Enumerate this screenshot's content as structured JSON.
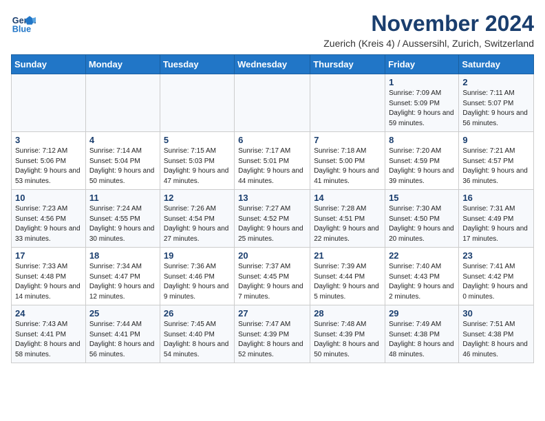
{
  "logo": {
    "line1": "General",
    "line2": "Blue"
  },
  "title": "November 2024",
  "subtitle": "Zuerich (Kreis 4) / Aussersihl, Zurich, Switzerland",
  "days_of_week": [
    "Sunday",
    "Monday",
    "Tuesday",
    "Wednesday",
    "Thursday",
    "Friday",
    "Saturday"
  ],
  "weeks": [
    [
      {
        "day": "",
        "info": ""
      },
      {
        "day": "",
        "info": ""
      },
      {
        "day": "",
        "info": ""
      },
      {
        "day": "",
        "info": ""
      },
      {
        "day": "",
        "info": ""
      },
      {
        "day": "1",
        "info": "Sunrise: 7:09 AM\nSunset: 5:09 PM\nDaylight: 9 hours and 59 minutes."
      },
      {
        "day": "2",
        "info": "Sunrise: 7:11 AM\nSunset: 5:07 PM\nDaylight: 9 hours and 56 minutes."
      }
    ],
    [
      {
        "day": "3",
        "info": "Sunrise: 7:12 AM\nSunset: 5:06 PM\nDaylight: 9 hours and 53 minutes."
      },
      {
        "day": "4",
        "info": "Sunrise: 7:14 AM\nSunset: 5:04 PM\nDaylight: 9 hours and 50 minutes."
      },
      {
        "day": "5",
        "info": "Sunrise: 7:15 AM\nSunset: 5:03 PM\nDaylight: 9 hours and 47 minutes."
      },
      {
        "day": "6",
        "info": "Sunrise: 7:17 AM\nSunset: 5:01 PM\nDaylight: 9 hours and 44 minutes."
      },
      {
        "day": "7",
        "info": "Sunrise: 7:18 AM\nSunset: 5:00 PM\nDaylight: 9 hours and 41 minutes."
      },
      {
        "day": "8",
        "info": "Sunrise: 7:20 AM\nSunset: 4:59 PM\nDaylight: 9 hours and 39 minutes."
      },
      {
        "day": "9",
        "info": "Sunrise: 7:21 AM\nSunset: 4:57 PM\nDaylight: 9 hours and 36 minutes."
      }
    ],
    [
      {
        "day": "10",
        "info": "Sunrise: 7:23 AM\nSunset: 4:56 PM\nDaylight: 9 hours and 33 minutes."
      },
      {
        "day": "11",
        "info": "Sunrise: 7:24 AM\nSunset: 4:55 PM\nDaylight: 9 hours and 30 minutes."
      },
      {
        "day": "12",
        "info": "Sunrise: 7:26 AM\nSunset: 4:54 PM\nDaylight: 9 hours and 27 minutes."
      },
      {
        "day": "13",
        "info": "Sunrise: 7:27 AM\nSunset: 4:52 PM\nDaylight: 9 hours and 25 minutes."
      },
      {
        "day": "14",
        "info": "Sunrise: 7:28 AM\nSunset: 4:51 PM\nDaylight: 9 hours and 22 minutes."
      },
      {
        "day": "15",
        "info": "Sunrise: 7:30 AM\nSunset: 4:50 PM\nDaylight: 9 hours and 20 minutes."
      },
      {
        "day": "16",
        "info": "Sunrise: 7:31 AM\nSunset: 4:49 PM\nDaylight: 9 hours and 17 minutes."
      }
    ],
    [
      {
        "day": "17",
        "info": "Sunrise: 7:33 AM\nSunset: 4:48 PM\nDaylight: 9 hours and 14 minutes."
      },
      {
        "day": "18",
        "info": "Sunrise: 7:34 AM\nSunset: 4:47 PM\nDaylight: 9 hours and 12 minutes."
      },
      {
        "day": "19",
        "info": "Sunrise: 7:36 AM\nSunset: 4:46 PM\nDaylight: 9 hours and 9 minutes."
      },
      {
        "day": "20",
        "info": "Sunrise: 7:37 AM\nSunset: 4:45 PM\nDaylight: 9 hours and 7 minutes."
      },
      {
        "day": "21",
        "info": "Sunrise: 7:39 AM\nSunset: 4:44 PM\nDaylight: 9 hours and 5 minutes."
      },
      {
        "day": "22",
        "info": "Sunrise: 7:40 AM\nSunset: 4:43 PM\nDaylight: 9 hours and 2 minutes."
      },
      {
        "day": "23",
        "info": "Sunrise: 7:41 AM\nSunset: 4:42 PM\nDaylight: 9 hours and 0 minutes."
      }
    ],
    [
      {
        "day": "24",
        "info": "Sunrise: 7:43 AM\nSunset: 4:41 PM\nDaylight: 8 hours and 58 minutes."
      },
      {
        "day": "25",
        "info": "Sunrise: 7:44 AM\nSunset: 4:41 PM\nDaylight: 8 hours and 56 minutes."
      },
      {
        "day": "26",
        "info": "Sunrise: 7:45 AM\nSunset: 4:40 PM\nDaylight: 8 hours and 54 minutes."
      },
      {
        "day": "27",
        "info": "Sunrise: 7:47 AM\nSunset: 4:39 PM\nDaylight: 8 hours and 52 minutes."
      },
      {
        "day": "28",
        "info": "Sunrise: 7:48 AM\nSunset: 4:39 PM\nDaylight: 8 hours and 50 minutes."
      },
      {
        "day": "29",
        "info": "Sunrise: 7:49 AM\nSunset: 4:38 PM\nDaylight: 8 hours and 48 minutes."
      },
      {
        "day": "30",
        "info": "Sunrise: 7:51 AM\nSunset: 4:38 PM\nDaylight: 8 hours and 46 minutes."
      }
    ]
  ]
}
